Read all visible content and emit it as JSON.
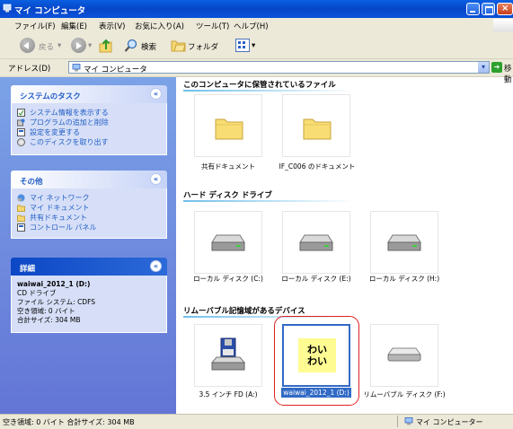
{
  "window": {
    "title": "マイ コンピュータ"
  },
  "menu": [
    "ファイル(F)",
    "編集(E)",
    "表示(V)",
    "お気に入り(A)",
    "ツール(T)",
    "ヘルプ(H)"
  ],
  "toolbar": {
    "back": "戻る",
    "search": "検索",
    "folders": "フォルダ"
  },
  "address": {
    "label": "アドレス(D)",
    "value": "マイ コンピュータ",
    "go": "移動"
  },
  "left": {
    "system_tasks": {
      "title": "システムのタスク",
      "items": [
        "システム情報を表示する",
        "プログラムの追加と削除",
        "設定を変更する",
        "このディスクを取り出す"
      ]
    },
    "other_places": {
      "title": "その他",
      "items": [
        "マイ ネットワーク",
        "マイ ドキュメント",
        "共有ドキュメント",
        "コントロール パネル"
      ]
    },
    "details": {
      "title": "詳細",
      "name": "waiwai_2012_1 (D:)",
      "type": "CD ドライブ",
      "fs": "ファイル システム: CDFS",
      "free": "空き領域: 0 バイト",
      "total": "合計サイズ: 304 MB"
    }
  },
  "main": {
    "sections": {
      "stored": "このコンピュータに保管されているファイル",
      "hdd": "ハード ディスク ドライブ",
      "removable": "リムーバブル記憶域があるデバイス"
    },
    "items": {
      "shared_docs": "共有ドキュメント",
      "user_docs": "IF_C006 のドキュメント",
      "drive_c": "ローカル ディスク (C:)",
      "drive_e": "ローカル ディスク (E:)",
      "drive_h": "ローカル ディスク (H:)",
      "floppy": "3.5 インチ FD (A:)",
      "cd": "waiwai_2012_1 (D:)",
      "cd_art": "わい\nわい",
      "removable_f": "リムーバブル ディスク (F:)"
    }
  },
  "status": {
    "left": "空き領域: 0 バイト 合計サイズ: 304 MB",
    "right": "マイ コンピューター"
  },
  "colors": {
    "title_blue": "#0a5fe0",
    "panel_blue": "#6375d6",
    "highlight": "#316ac5",
    "annotation_red": "#e02020"
  }
}
